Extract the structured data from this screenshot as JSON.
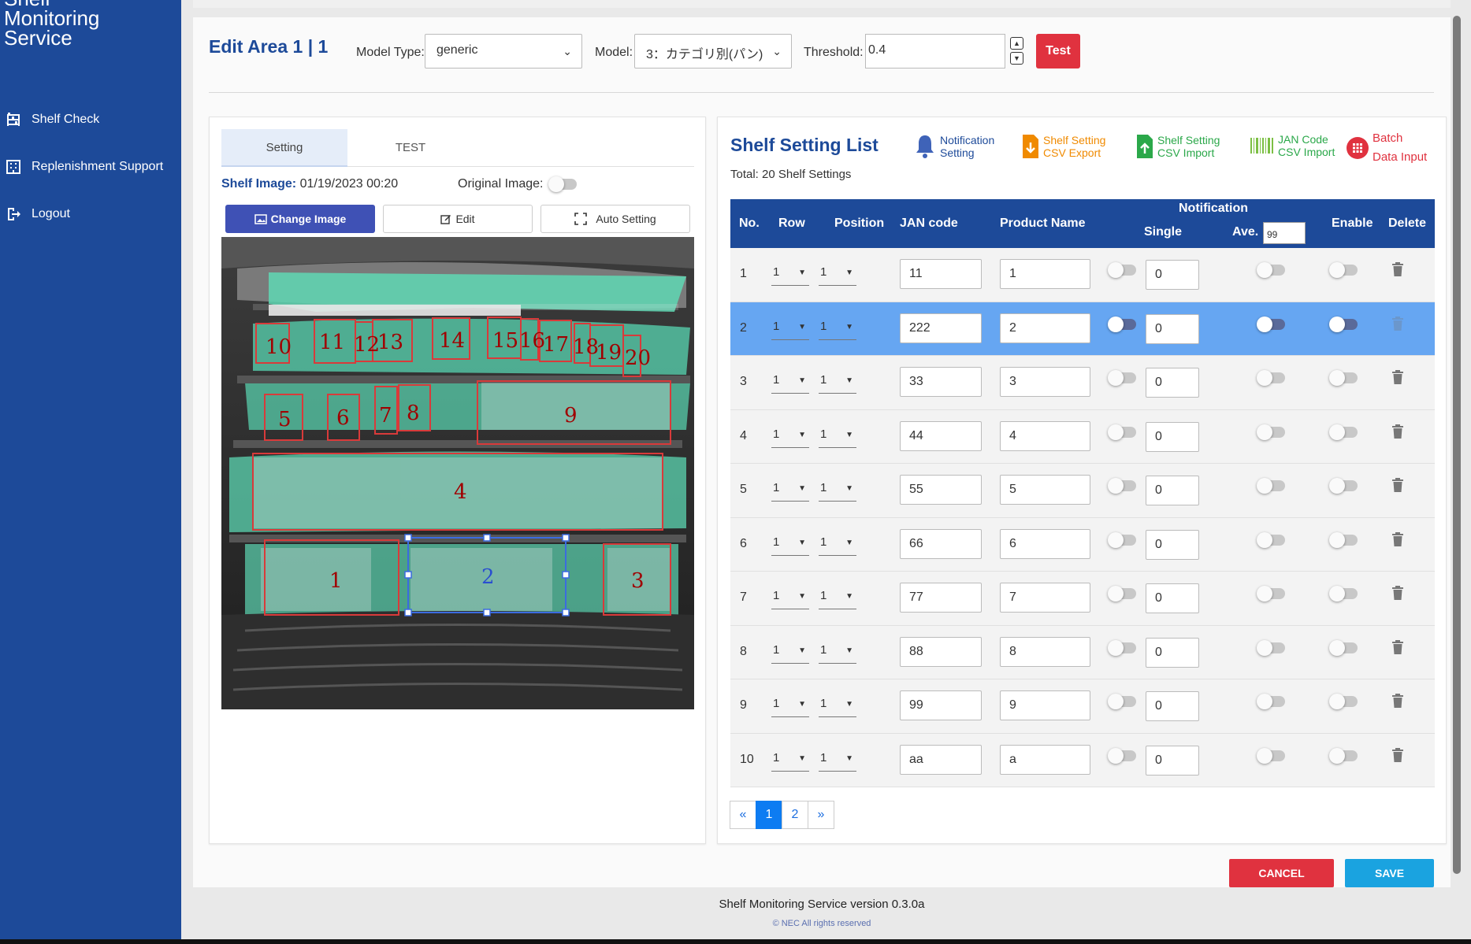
{
  "app": {
    "brand_line1": "Shelf",
    "brand_line2": "Monitoring",
    "brand_line3": "Service"
  },
  "nav": [
    {
      "label": "Shelf Check",
      "icon": "shelf-icon"
    },
    {
      "label": "Replenishment Support",
      "icon": "building-icon"
    },
    {
      "label": "Logout",
      "icon": "logout-icon"
    }
  ],
  "header": {
    "title": "Edit Area 1 | 1",
    "model_type_label": "Model Type:",
    "model_type_value": "generic",
    "model_label": "Model:",
    "model_value": "3：カテゴリ別(パン)",
    "threshold_label": "Threshold:",
    "threshold_value": "0.4",
    "test_label": "Test"
  },
  "left": {
    "tab_setting": "Setting",
    "tab_test": "TEST",
    "shelf_image_label": "Shelf Image:",
    "shelf_image_date": "01/19/2023 00:20",
    "original_image_label": "Original Image:",
    "change_image": "Change Image",
    "edit": "Edit",
    "auto_setting": "Auto Setting"
  },
  "right": {
    "title": "Shelf Setting List",
    "total": "Total: 20 Shelf Settings",
    "actions": {
      "notif1": "Notification",
      "notif2": "Setting",
      "export1": "Shelf Setting",
      "export2": "CSV Export",
      "import1": "Shelf Setting",
      "import2": "CSV Import",
      "jan1": "JAN Code",
      "jan2": "CSV Import",
      "batch1": "Batch",
      "batch2": "Data Input"
    },
    "colors": {
      "orange": "#f08a00",
      "green": "#2ba84a",
      "red": "#e0323f",
      "blue": "#1d4a99"
    },
    "columns": {
      "no": "No.",
      "row": "Row",
      "position": "Position",
      "jan": "JAN code",
      "product": "Product Name",
      "notification": "Notification",
      "single": "Single",
      "ave": "Ave.",
      "ave_value": "99",
      "enable": "Enable",
      "delete": "Delete"
    },
    "rows": [
      {
        "no": "1",
        "row": "1",
        "pos": "1",
        "jan": "11",
        "name": "1",
        "single": "0"
      },
      {
        "no": "2",
        "row": "1",
        "pos": "1",
        "jan": "222",
        "name": "2",
        "single": "0"
      },
      {
        "no": "3",
        "row": "1",
        "pos": "1",
        "jan": "33",
        "name": "3",
        "single": "0"
      },
      {
        "no": "4",
        "row": "1",
        "pos": "1",
        "jan": "44",
        "name": "4",
        "single": "0"
      },
      {
        "no": "5",
        "row": "1",
        "pos": "1",
        "jan": "55",
        "name": "5",
        "single": "0"
      },
      {
        "no": "6",
        "row": "1",
        "pos": "1",
        "jan": "66",
        "name": "6",
        "single": "0"
      },
      {
        "no": "7",
        "row": "1",
        "pos": "1",
        "jan": "77",
        "name": "7",
        "single": "0"
      },
      {
        "no": "8",
        "row": "1",
        "pos": "1",
        "jan": "88",
        "name": "8",
        "single": "0"
      },
      {
        "no": "9",
        "row": "1",
        "pos": "1",
        "jan": "99",
        "name": "9",
        "single": "0"
      },
      {
        "no": "10",
        "row": "1",
        "pos": "1",
        "jan": "aa",
        "name": "a",
        "single": "0"
      }
    ],
    "pager": {
      "prev": "«",
      "p1": "1",
      "p2": "2",
      "next": "»"
    }
  },
  "shelf_labels": [
    "10",
    "11",
    "12",
    "13",
    "14",
    "15",
    "16",
    "17",
    "18",
    "19",
    "20",
    "5",
    "6",
    "7",
    "8",
    "9",
    "4",
    "1",
    "2",
    "3"
  ],
  "footer": {
    "cancel": "CANCEL",
    "save": "SAVE",
    "version": "Shelf Monitoring Service version 0.3.0a",
    "copyright": "© NEC All rights reserved"
  }
}
